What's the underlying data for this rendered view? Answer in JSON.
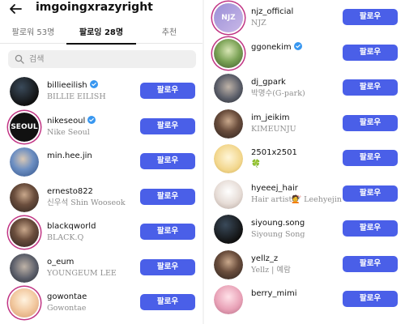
{
  "header": {
    "username": "imgoingxrazyright"
  },
  "tabs": [
    {
      "label": "팔로워 53명"
    },
    {
      "label": "팔로잉 28명"
    },
    {
      "label": "추천"
    }
  ],
  "search": {
    "placeholder": "검색"
  },
  "follow_label": "팔로우",
  "left_list": [
    {
      "handle": "billieeilish",
      "name": "BILLIE EILISH",
      "verified": true,
      "avatar": "dark-photo"
    },
    {
      "handle": "nikeseoul",
      "name": "Nike Seoul",
      "verified": true,
      "avatar": "seoul-logo",
      "avatar_text": "SEOUL"
    },
    {
      "handle": "min.hee.jin",
      "name": "",
      "verified": false,
      "avatar": "blue-photo"
    },
    {
      "handle": "ernesto822",
      "name": "신우석 Shin Wooseok",
      "verified": false,
      "avatar": "portrait-photo"
    },
    {
      "handle": "blackqworld",
      "name": "BLACK.Q",
      "verified": false,
      "avatar": "portrait-photo"
    },
    {
      "handle": "o_eum",
      "name": "YOUNGEUM LEE",
      "verified": false,
      "avatar": "photo"
    },
    {
      "handle": "gowontae",
      "name": "Gowontae",
      "verified": false,
      "avatar": "warm-photo"
    }
  ],
  "right_list": [
    {
      "handle": "njz_official",
      "name": "NJZ",
      "verified": false,
      "avatar": "njz-logo",
      "avatar_text": "NJZ"
    },
    {
      "handle": "ggonekim",
      "name": "",
      "verified": true,
      "avatar": "outdoor-photo"
    },
    {
      "handle": "dj_gpark",
      "name": "박명수(G-park)",
      "verified": false,
      "avatar": "photo"
    },
    {
      "handle": "im_jeikim",
      "name": "KIMEUNJU",
      "verified": false,
      "avatar": "portrait-photo"
    },
    {
      "handle": "2501x2501",
      "name": "🍀",
      "verified": false,
      "avatar": "illustration"
    },
    {
      "handle": "hyeeej_hair",
      "name": "Hair artist💇 Leehyejin",
      "verified": false,
      "avatar": "light-photo"
    },
    {
      "handle": "siyoung.song",
      "name": "Siyoung Song",
      "verified": false,
      "avatar": "dark-photo"
    },
    {
      "handle": "yellz_z",
      "name": "Yellz | 예람",
      "verified": false,
      "avatar": "portrait-photo"
    },
    {
      "handle": "berry_mimi",
      "name": "",
      "verified": false,
      "avatar": "pink-photo"
    }
  ],
  "colors": {
    "follow_button": "#4a5fe8",
    "verified_badge": "#3897f0",
    "story_ring": "#c13584",
    "secondary_text": "#8e8e8e"
  }
}
